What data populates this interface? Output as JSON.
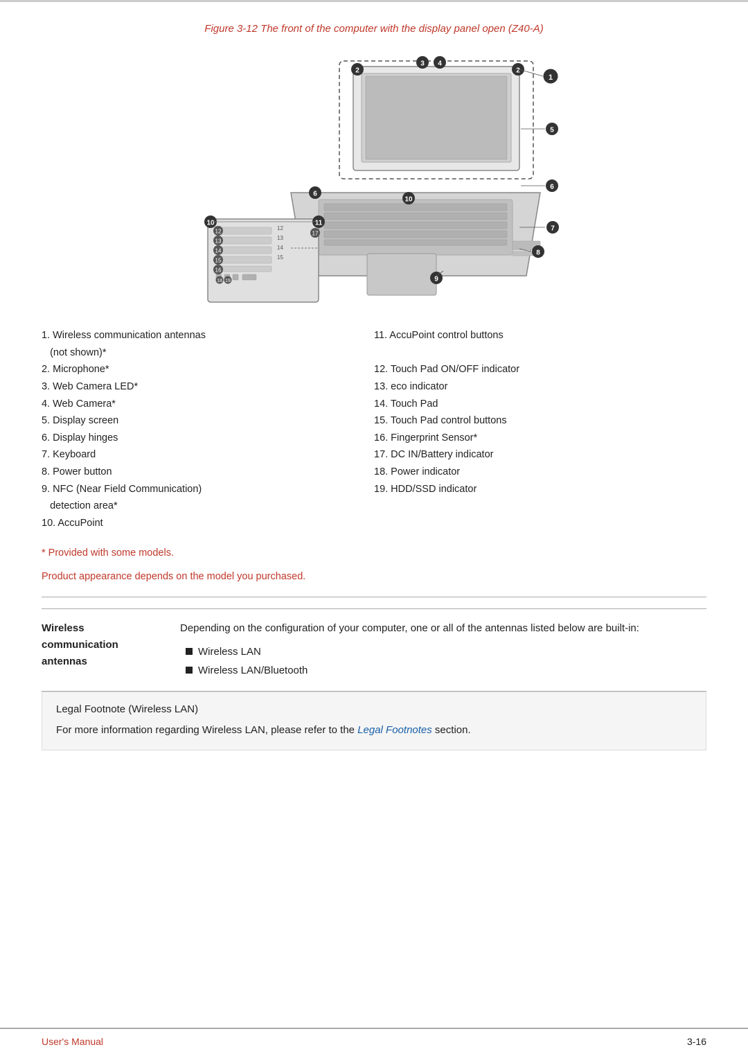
{
  "page": {
    "top_border": true,
    "figure_caption": "Figure 3-12 The front of the computer with the display panel open (Z40-A)",
    "parts_left": [
      "1. Wireless communication antennas",
      "(not shown)*",
      "2. Microphone*",
      "3. Web Camera LED*",
      "4. Web Camera*",
      "5. Display screen",
      "6. Display hinges",
      "7. Keyboard",
      "8. Power button",
      "9. NFC (Near Field Communication)",
      "detection area*",
      "10. AccuPoint"
    ],
    "parts_right": [
      "11. AccuPoint control buttons",
      "",
      "12. Touch Pad ON/OFF indicator",
      "13. eco indicator",
      "14. Touch Pad",
      "15. Touch Pad control buttons",
      "16. Fingerprint Sensor*",
      "17. DC IN/Battery indicator",
      "18. Power indicator",
      "19. HDD/SSD indicator"
    ],
    "note1": "* Provided with some models.",
    "note2": "Product appearance depends on the model you purchased.",
    "wireless_label_line1": "Wireless",
    "wireless_label_line2": "communication",
    "wireless_label_line3": "antennas",
    "wireless_desc": "Depending on the configuration of your computer, one or all of the antennas listed below are built-in:",
    "wireless_bullets": [
      "Wireless LAN",
      "Wireless LAN/Bluetooth"
    ],
    "legal_title": "Legal Footnote (Wireless LAN)",
    "legal_text_before": "For more information regarding Wireless LAN, please refer to the ",
    "legal_link": "Legal Footnotes",
    "legal_text_after": " section.",
    "footer_left": "User's Manual",
    "footer_right": "3-16"
  }
}
